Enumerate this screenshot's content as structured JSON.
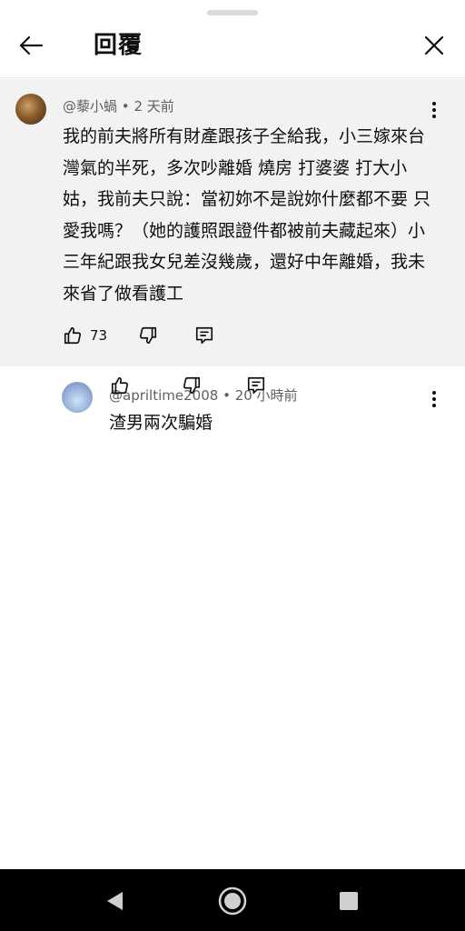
{
  "header": {
    "title": "回覆"
  },
  "comment": {
    "author": "@藜小蝸",
    "time": "2 天前",
    "text": "我的前夫將所有財產跟孩子全給我，小三嫁來台灣氣的半死，多次吵離婚 燒房 打婆婆 打大小姑，我前夫只說：當初妳不是說妳什麼都不要 只愛我嗎？（她的護照跟證件都被前夫藏起來）小三年紀跟我女兒差沒幾歲，還好中年離婚，我未來省了做看護工",
    "likes": "73"
  },
  "reply": {
    "author": "@apriltime2008",
    "time": "20 小時前",
    "text": "渣男兩次騙婚"
  },
  "separator": "•",
  "colors": {
    "highlight_bg": "#f2f2f2",
    "meta_text": "#606060",
    "nav_bar": "#000000"
  }
}
